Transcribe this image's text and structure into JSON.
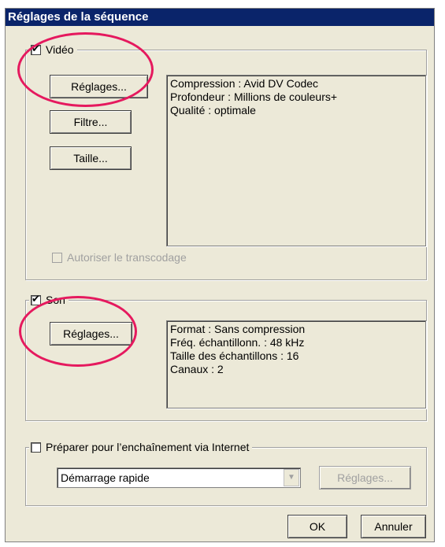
{
  "window": {
    "title": "Réglages de la séquence"
  },
  "video": {
    "label": "Vidéo",
    "checked": true,
    "buttons": {
      "settings": "Réglages...",
      "filter": "Filtre...",
      "size": "Taille..."
    },
    "info": [
      "Compression : Avid DV Codec",
      "Profondeur : Millions de couleurs+",
      "Qualité : optimale"
    ],
    "transcode_label": "Autoriser le transcodage"
  },
  "sound": {
    "label": "Son",
    "checked": true,
    "buttons": {
      "settings": "Réglages..."
    },
    "info": [
      "Format : Sans compression",
      "Fréq. échantillonn. : 48 kHz",
      "Taille des échantillons : 16",
      "Canaux : 2"
    ]
  },
  "internet": {
    "label": "Préparer pour l’enchaînement via Internet",
    "checked": false,
    "select_value": "Démarrage rapide",
    "settings_label": "Réglages..."
  },
  "footer": {
    "ok": "OK",
    "cancel": "Annuler"
  },
  "colors": {
    "highlight_circle": "#e5195e",
    "titlebar": "#0a246a"
  }
}
